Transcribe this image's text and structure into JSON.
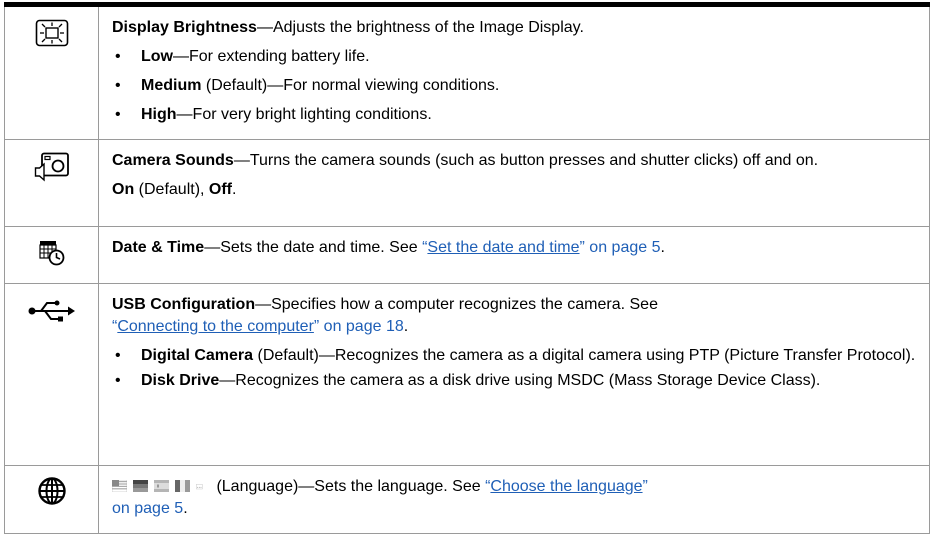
{
  "rows": [
    {
      "icon": "display-brightness-icon",
      "title": "Display Brightness",
      "desc": "—Adjusts the brightness of the Image Display.",
      "bullets": [
        {
          "bold": "Low",
          "text": "—For extending battery life."
        },
        {
          "bold": "Medium",
          "text": " (Default)—For normal viewing conditions."
        },
        {
          "bold": "High",
          "text": "—For very bright lighting conditions."
        }
      ]
    },
    {
      "icon": "camera-sounds-icon",
      "title": "Camera Sounds",
      "desc": "—Turns the camera sounds (such as button presses and shutter clicks) off and on.",
      "options": {
        "on": "On",
        "on_suffix": " (Default), ",
        "off": "Off",
        "end": "."
      }
    },
    {
      "icon": "date-time-icon",
      "title": "Date & Time",
      "desc": "—Sets the date and time. See ",
      "link_open": "“",
      "link": "Set the date and time",
      "link_close": "” on page 5",
      "end": "."
    },
    {
      "icon": "usb-icon",
      "title": "USB Configuration",
      "desc": "—Specifies how a computer recognizes the camera. See",
      "link_open": "“",
      "link": "Connecting to the computer",
      "link_close": "” on page 18",
      "end": ".",
      "bullets": [
        {
          "bold": "Digital Camera",
          "text": "  (Default)—Recognizes the camera as a digital camera using PTP (Picture Transfer Protocol)."
        },
        {
          "bold": "Disk Drive",
          "text": "—Recognizes the camera as a disk drive using MSDC (Mass Storage Device Class)."
        }
      ]
    },
    {
      "icon": "globe-icon",
      "desc": " (Language)—Sets the language. See ",
      "link_open": "“",
      "link": "Choose the language",
      "link_close": "”",
      "link_line2": "on page 5",
      "end": "."
    }
  ],
  "colors": {
    "link": "#1f5fb6",
    "rule": "#9a9a9a"
  }
}
